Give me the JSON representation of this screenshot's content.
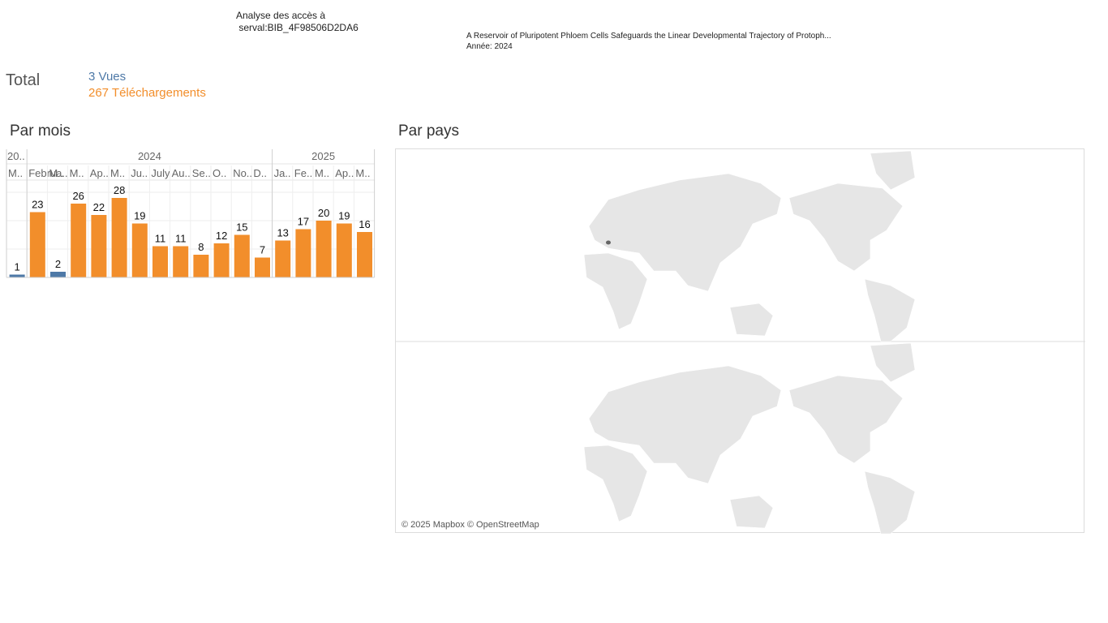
{
  "header": {
    "title": "Analyse des accès à\n serval:BIB_4F98506D2DA6",
    "paper_title": "A Reservoir of Pluripotent Phloem Cells Safeguards the Linear Developmental Trajectory of Protoph...",
    "paper_year": "Année: 2024"
  },
  "totals": {
    "label": "Total",
    "views": "3 Vues",
    "downloads": "267 Téléchargements"
  },
  "sections": {
    "by_month": "Par mois",
    "by_country": "Par pays"
  },
  "colors": {
    "views": "#4e79a7",
    "downloads": "#f28e2b",
    "land": "#e6e6e6",
    "highlight": "#666666"
  },
  "chart_data": {
    "type": "bar",
    "year_labels": [
      "20..",
      "2024",
      "2025"
    ],
    "categories": [
      "M..",
      "Februa..",
      "M..",
      "M..",
      "Ap..",
      "M..",
      "Ju..",
      "July",
      "Au..",
      "Se..",
      "O..",
      "No..",
      "D..",
      "Ja..",
      "Fe..",
      "M..",
      "Ap..",
      "M.."
    ],
    "years": [
      "2023",
      "2024",
      "2024",
      "2024",
      "2024",
      "2024",
      "2024",
      "2024",
      "2024",
      "2024",
      "2024",
      "2024",
      "2024",
      "2025",
      "2025",
      "2025",
      "2025",
      "2025"
    ],
    "series": [
      {
        "name": "Vues",
        "values": [
          1,
          0,
          2,
          0,
          0,
          0,
          0,
          0,
          0,
          0,
          0,
          0,
          0,
          0,
          0,
          0,
          0,
          0
        ]
      },
      {
        "name": "Téléchargements",
        "values": [
          0,
          23,
          0,
          26,
          22,
          28,
          19,
          11,
          11,
          8,
          12,
          15,
          7,
          13,
          17,
          20,
          19,
          16
        ]
      }
    ],
    "bar_values": [
      1,
      23,
      2,
      26,
      22,
      28,
      19,
      11,
      11,
      8,
      12,
      15,
      7,
      13,
      17,
      20,
      19,
      16
    ],
    "bar_series": [
      "Vues",
      "Téléchargements",
      "Vues",
      "Téléchargements",
      "Téléchargements",
      "Téléchargements",
      "Téléchargements",
      "Téléchargements",
      "Téléchargements",
      "Téléchargements",
      "Téléchargements",
      "Téléchargements",
      "Téléchargements",
      "Téléchargements",
      "Téléchargements",
      "Téléchargements",
      "Téléchargements",
      "Téléchargements"
    ],
    "ylim": [
      0,
      30
    ],
    "grid": true
  },
  "map": {
    "type": "map",
    "attribution": "© 2025 Mapbox © OpenStreetMap",
    "highlighted_country": "Switzerland"
  }
}
